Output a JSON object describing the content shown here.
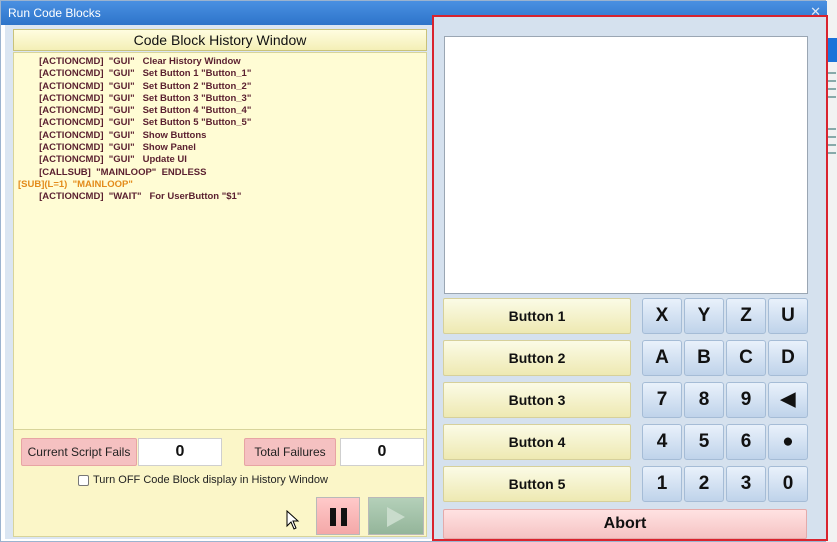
{
  "window": {
    "title": "Run Code Blocks"
  },
  "history": {
    "header": "Code Block History Window",
    "lines": [
      {
        "text": "        [ACTIONCMD]  \"GUI\"   Clear History Window",
        "kind": "cmd"
      },
      {
        "text": "        [ACTIONCMD]  \"GUI\"   Set Button 1 \"Button_1\"",
        "kind": "cmd"
      },
      {
        "text": "        [ACTIONCMD]  \"GUI\"   Set Button 2 \"Button_2\"",
        "kind": "cmd"
      },
      {
        "text": "        [ACTIONCMD]  \"GUI\"   Set Button 3 \"Button_3\"",
        "kind": "cmd"
      },
      {
        "text": "        [ACTIONCMD]  \"GUI\"   Set Button 4 \"Button_4\"",
        "kind": "cmd"
      },
      {
        "text": "        [ACTIONCMD]  \"GUI\"   Set Button 5 \"Button_5\"",
        "kind": "cmd"
      },
      {
        "text": "        [ACTIONCMD]  \"GUI\"   Show Buttons",
        "kind": "cmd"
      },
      {
        "text": "        [ACTIONCMD]  \"GUI\"   Show Panel",
        "kind": "cmd"
      },
      {
        "text": "        [ACTIONCMD]  \"GUI\"   Update UI",
        "kind": "cmd"
      },
      {
        "text": "        [CALLSUB]  \"MAINLOOP\"  ENDLESS",
        "kind": "cmd"
      },
      {
        "text": "[SUB](L=1)  \"MAINLOOP\"",
        "kind": "sub"
      },
      {
        "text": "        [ACTIONCMD]  \"WAIT\"   For UserButton \"$1\"",
        "kind": "cmd"
      }
    ]
  },
  "stats": {
    "current_fails_label": "Current Script Fails",
    "current_fails_value": "0",
    "total_failures_label": "Total Failures",
    "total_failures_value": "0",
    "checkbox_label": "Turn OFF Code Block display in History Window"
  },
  "user_buttons": [
    "Button 1",
    "Button 2",
    "Button 3",
    "Button 4",
    "Button 5"
  ],
  "keypad": [
    [
      "X",
      "Y",
      "Z",
      "U"
    ],
    [
      "A",
      "B",
      "C",
      "D"
    ],
    [
      "7",
      "8",
      "9",
      "◀"
    ],
    [
      "4",
      "5",
      "6",
      "●"
    ],
    [
      "1",
      "2",
      "3",
      "0"
    ]
  ],
  "abort_label": "Abort",
  "colors": {
    "accent_frame": "#d9232e",
    "history_bg": "#fffcd4",
    "sub_text": "#e38b1b",
    "cmd_text": "#5a1f2f"
  }
}
